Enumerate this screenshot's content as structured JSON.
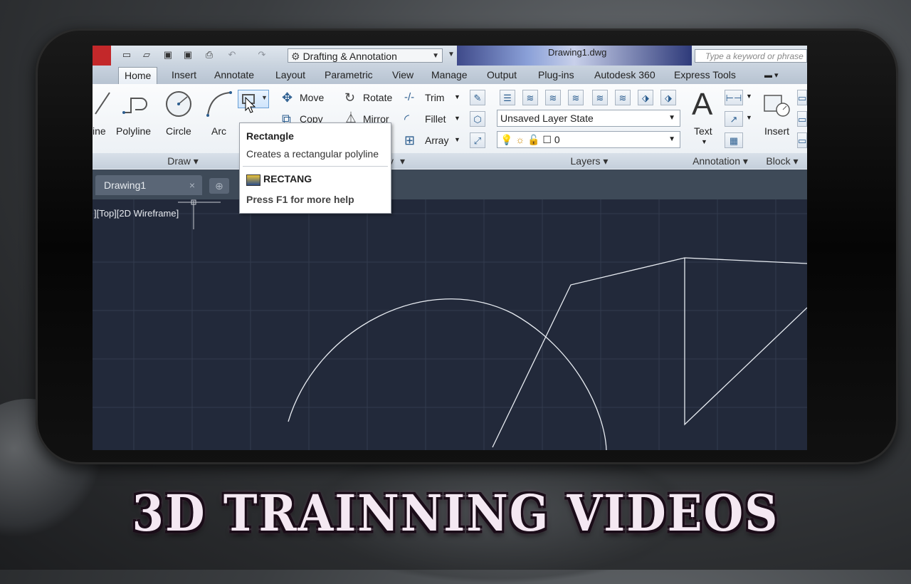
{
  "app": {
    "workspace": "Drafting & Annotation",
    "doc_title": "Drawing1.dwg",
    "search_placeholder": "Type a keyword or phrase"
  },
  "tabs": [
    {
      "label": "Home",
      "active": true
    },
    {
      "label": "Insert"
    },
    {
      "label": "Annotate"
    },
    {
      "label": "Layout"
    },
    {
      "label": "Parametric"
    },
    {
      "label": "View"
    },
    {
      "label": "Manage"
    },
    {
      "label": "Output"
    },
    {
      "label": "Plug-ins"
    },
    {
      "label": "Autodesk 360"
    },
    {
      "label": "Express Tools"
    }
  ],
  "ribbon": {
    "draw": {
      "line_label": "ine",
      "polyline_label": "Polyline",
      "circle_label": "Circle",
      "arc_label": "Arc",
      "footer": "Draw"
    },
    "modify": {
      "move": "Move",
      "rotate": "Rotate",
      "trim": "Trim",
      "copy": "Copy",
      "mirror": "Mirror",
      "fillet": "Fillet",
      "array": "Array",
      "footer_partial": "y"
    },
    "layers": {
      "layer_state": "Unsaved Layer State",
      "current_layer": "0",
      "footer": "Layers"
    },
    "annotation": {
      "text_label": "Text",
      "footer": "Annotation"
    },
    "block": {
      "insert_label": "Insert",
      "footer": "Block"
    }
  },
  "tooltip": {
    "title": "Rectangle",
    "description": "Creates a rectangular polyline",
    "command": "RECTANG",
    "help": "Press F1 for more help"
  },
  "file_tab": {
    "name": "Drawing1"
  },
  "viewport": {
    "label": "][Top][2D Wireframe]"
  },
  "banner": {
    "text": "3D TRAINNING VIDEOS"
  },
  "colors": {
    "canvas_bg": "#22293a",
    "grid": "#333c4e",
    "geometry": "#e8ecf2",
    "app_button": "#c3282a"
  }
}
